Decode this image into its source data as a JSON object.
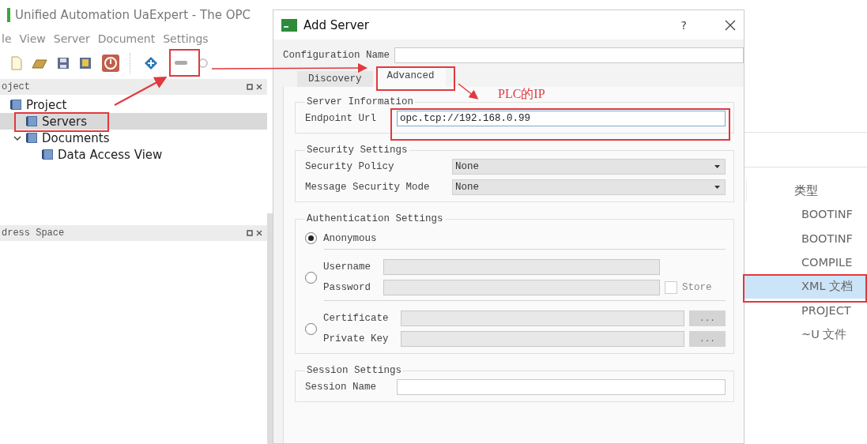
{
  "main_window": {
    "title": "Unified Automation UaExpert - The OPC",
    "menu": [
      "le",
      "View",
      "Server",
      "Document",
      "Settings"
    ],
    "project_panel": {
      "title": "oject",
      "tree": [
        {
          "label": "Project",
          "selected": false,
          "children": [
            {
              "label": "Servers",
              "selected": true
            },
            {
              "label": "Documents",
              "selected": false,
              "expanded": true,
              "children": [
                {
                  "label": "Data Access View",
                  "selected": false
                }
              ]
            }
          ]
        }
      ]
    },
    "address_panel": {
      "title": "dress Space"
    }
  },
  "dialog": {
    "title": "Add Server",
    "help": "?",
    "configuration_name": {
      "label": "Configuration Name"
    },
    "tabs": [
      {
        "label": "Discovery",
        "selected": false
      },
      {
        "label": "Advanced",
        "selected": true
      }
    ],
    "server_information": {
      "title": "Server Information",
      "endpoint_url": {
        "label": "Endpoint Url",
        "value": "opc.tcp://192.168.0.99"
      }
    },
    "security_settings": {
      "title": "Security Settings",
      "fields": [
        {
          "label": "Security Policy",
          "value": "None"
        },
        {
          "label": "Message Security Mode",
          "value": "None"
        }
      ]
    },
    "authentication_settings": {
      "title": "Authentication Settings",
      "options": [
        {
          "kind": "anonymous",
          "selected": true,
          "label": "Anonymous"
        },
        {
          "kind": "user",
          "selected": false,
          "fields": [
            {
              "label": "Username"
            },
            {
              "label": "Password"
            }
          ],
          "store": {
            "label": "Store",
            "checked": false
          }
        },
        {
          "kind": "certificate",
          "selected": false,
          "fields": [
            {
              "label": "Certificate",
              "browse": "..."
            },
            {
              "label": "Private Key",
              "browse": "..."
            }
          ]
        }
      ]
    },
    "session_settings": {
      "title": "Session Settings",
      "session_name": {
        "label": "Session Name"
      }
    }
  },
  "file_list": {
    "header": "类型",
    "items": [
      {
        "label": "BOOTINF",
        "selected": false
      },
      {
        "label": "BOOTINF",
        "selected": false
      },
      {
        "label": "COMPILE",
        "selected": false
      },
      {
        "label": "XML 文档",
        "selected": true
      },
      {
        "label": "PROJECT",
        "selected": false
      },
      {
        "label": "~U 文件",
        "selected": false
      }
    ]
  },
  "annotation": {
    "note": "PLC的IP"
  }
}
